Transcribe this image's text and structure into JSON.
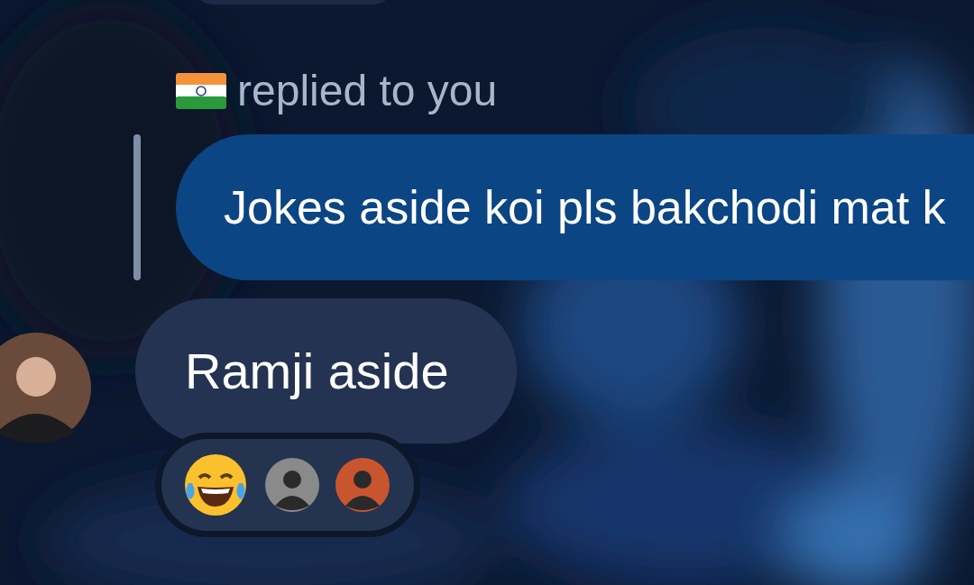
{
  "reply": {
    "label": "replied to you",
    "quoted_text": "Jokes aside koi pls bakchodi mat k"
  },
  "message": {
    "text": "Ramji aside"
  },
  "reactions": [
    {
      "kind": "emoji"
    },
    {
      "kind": "avatar"
    },
    {
      "kind": "avatar"
    }
  ]
}
